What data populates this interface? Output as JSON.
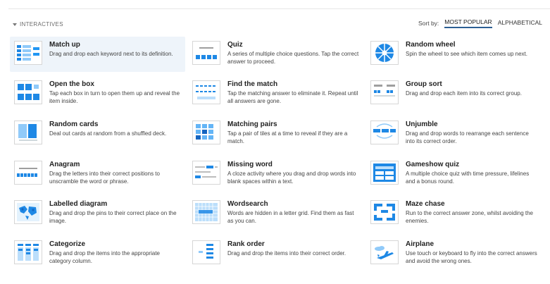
{
  "section": {
    "label": "INTERACTIVES"
  },
  "sort": {
    "label": "Sort by:",
    "options": [
      "MOST POPULAR",
      "ALPHABETICAL"
    ],
    "selected": "MOST POPULAR"
  },
  "tiles": [
    {
      "title": "Match up",
      "desc": "Drag and drop each keyword next to its definition.",
      "icon": "match-up-icon"
    },
    {
      "title": "Quiz",
      "desc": "A series of multiple choice questions. Tap the correct answer to proceed.",
      "icon": "quiz-icon"
    },
    {
      "title": "Random wheel",
      "desc": "Spin the wheel to see which item comes up next.",
      "icon": "random-wheel-icon"
    },
    {
      "title": "Open the box",
      "desc": "Tap each box in turn to open them up and reveal the item inside.",
      "icon": "open-the-box-icon"
    },
    {
      "title": "Find the match",
      "desc": "Tap the matching answer to eliminate it. Repeat until all answers are gone.",
      "icon": "find-the-match-icon"
    },
    {
      "title": "Group sort",
      "desc": "Drag and drop each item into its correct group.",
      "icon": "group-sort-icon"
    },
    {
      "title": "Random cards",
      "desc": "Deal out cards at random from a shuffled deck.",
      "icon": "random-cards-icon"
    },
    {
      "title": "Matching pairs",
      "desc": "Tap a pair of tiles at a time to reveal if they are a match.",
      "icon": "matching-pairs-icon"
    },
    {
      "title": "Unjumble",
      "desc": "Drag and drop words to rearrange each sentence into its correct order.",
      "icon": "unjumble-icon"
    },
    {
      "title": "Anagram",
      "desc": "Drag the letters into their correct positions to unscramble the word or phrase.",
      "icon": "anagram-icon"
    },
    {
      "title": "Missing word",
      "desc": "A cloze activity where you drag and drop words into blank spaces within a text.",
      "icon": "missing-word-icon"
    },
    {
      "title": "Gameshow quiz",
      "desc": "A multiple choice quiz with time pressure, lifelines and a bonus round.",
      "icon": "gameshow-quiz-icon"
    },
    {
      "title": "Labelled diagram",
      "desc": "Drag and drop the pins to their correct place on the image.",
      "icon": "labelled-diagram-icon"
    },
    {
      "title": "Wordsearch",
      "desc": "Words are hidden in a letter grid. Find them as fast as you can.",
      "icon": "wordsearch-icon"
    },
    {
      "title": "Maze chase",
      "desc": "Run to the correct answer zone, whilst avoiding the enemies.",
      "icon": "maze-chase-icon"
    },
    {
      "title": "Categorize",
      "desc": "Drag and drop the items into the appropriate category column.",
      "icon": "categorize-icon"
    },
    {
      "title": "Rank order",
      "desc": "Drag and drop the items into their correct order.",
      "icon": "rank-order-icon"
    },
    {
      "title": "Airplane",
      "desc": "Use touch or keyboard to fly into the correct answers and avoid the wrong ones.",
      "icon": "airplane-icon"
    }
  ],
  "colors": {
    "accent": "#2196f3",
    "dark": "#1565c0",
    "selected_bg": "#eef4fa",
    "sort_underline": "#2c5f93"
  }
}
